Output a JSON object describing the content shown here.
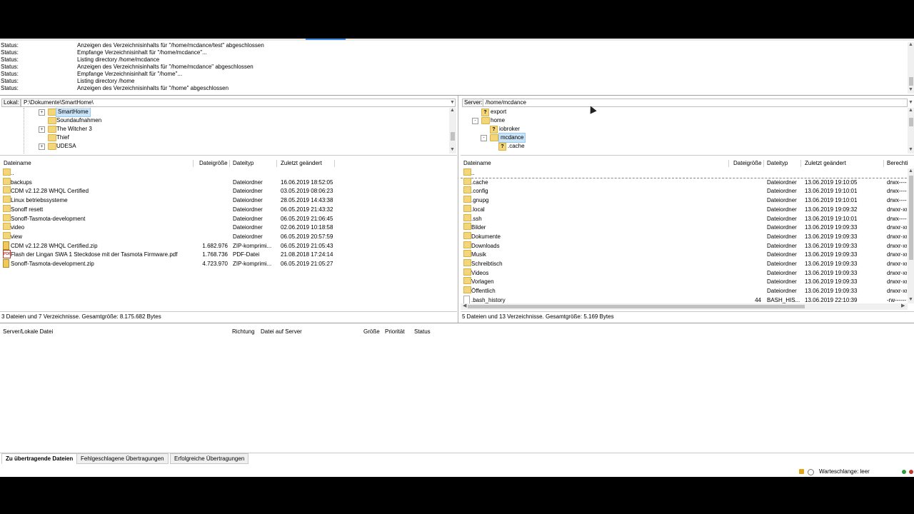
{
  "colors": {
    "selection": "#cce4f7",
    "folder": "#f3d57a",
    "topstrip_accent": "#3c8ddf"
  },
  "log": [
    {
      "k": "Status:",
      "v": "Anzeigen des Verzeichnisinhalts für \"/home/mcdance/test\" abgeschlossen"
    },
    {
      "k": "Status:",
      "v": "Empfange Verzeichnisinhalt für \"/home/mcdance\"..."
    },
    {
      "k": "Status:",
      "v": "Listing directory /home/mcdance"
    },
    {
      "k": "Status:",
      "v": "Anzeigen des Verzeichnisinhalts für \"/home/mcdance\" abgeschlossen"
    },
    {
      "k": "Status:",
      "v": "Empfange Verzeichnisinhalt für \"/home\"..."
    },
    {
      "k": "Status:",
      "v": "Listing directory /home"
    },
    {
      "k": "Status:",
      "v": "Anzeigen des Verzeichnisinhalts für \"/home\" abgeschlossen"
    }
  ],
  "local": {
    "label": "Lokal:",
    "path": "P:\\Dokumente\\SmartHome\\",
    "tree": [
      {
        "name": "SmartHome",
        "expand": "+",
        "selected": true
      },
      {
        "name": "Soundaufnahmen",
        "expand": ""
      },
      {
        "name": "The Witcher 3",
        "expand": "+"
      },
      {
        "name": "Thief",
        "expand": ""
      },
      {
        "name": "UDESA",
        "expand": "+"
      }
    ],
    "headers": {
      "name": "Dateiname",
      "size": "Dateigröße",
      "type": "Dateityp",
      "modified": "Zuletzt geändert"
    },
    "rows": [
      {
        "icon": "folder-icon",
        "name": "..",
        "size": "",
        "type": "",
        "modified": ""
      },
      {
        "icon": "folder-icon",
        "name": "backups",
        "size": "",
        "type": "Dateiordner",
        "modified": "16.06.2019 18:52:05"
      },
      {
        "icon": "folder-icon",
        "name": "CDM v2.12.28 WHQL Certified",
        "size": "",
        "type": "Dateiordner",
        "modified": "03.05.2019 08:06:23"
      },
      {
        "icon": "folder-icon",
        "name": "Linux betriebssysteme",
        "size": "",
        "type": "Dateiordner",
        "modified": "28.05.2019 14:43:38"
      },
      {
        "icon": "folder-icon",
        "name": "Sonoff resett",
        "size": "",
        "type": "Dateiordner",
        "modified": "06.05.2019 21:43:32"
      },
      {
        "icon": "folder-icon",
        "name": "Sonoff-Tasmota-development",
        "size": "",
        "type": "Dateiordner",
        "modified": "06.05.2019 21:06:45"
      },
      {
        "icon": "folder-icon",
        "name": "video",
        "size": "",
        "type": "Dateiordner",
        "modified": "02.06.2019 10:18:58"
      },
      {
        "icon": "folder-icon",
        "name": "view",
        "size": "",
        "type": "Dateiordner",
        "modified": "06.05.2019 20:57:59"
      },
      {
        "icon": "zip-icon",
        "name": "CDM v2.12.28 WHQL Certified.zip",
        "size": "1.682.976",
        "type": "ZIP-komprimi...",
        "modified": "06.05.2019 21:05:43"
      },
      {
        "icon": "pdf-icon",
        "name": "Flash der Lingan SWA 1 Steckdose mit der Tasmota Firmware.pdf",
        "size": "1.768.736",
        "type": "PDF-Datei",
        "modified": "21.08.2018 17:24:14"
      },
      {
        "icon": "zip-icon",
        "name": "Sonoff-Tasmota-development.zip",
        "size": "4.723.970",
        "type": "ZIP-komprimi...",
        "modified": "06.05.2019 21:05:27"
      }
    ],
    "summary": "3 Dateien und 7 Verzeichnisse. Gesamtgröße: 8.175.682 Bytes"
  },
  "remote": {
    "label": "Server:",
    "path": "/home/mcdance",
    "tree": [
      {
        "name": "export",
        "icon": "q",
        "expand": ""
      },
      {
        "name": "home",
        "icon": "folder",
        "expand": "-"
      },
      {
        "name": "iobroker",
        "icon": "q",
        "expand": ""
      },
      {
        "name": "mcdance",
        "icon": "folder",
        "expand": "-",
        "selected": true
      },
      {
        "name": ".cache",
        "icon": "q",
        "expand": ""
      }
    ],
    "headers": {
      "name": "Dateiname",
      "size": "Dateigröße",
      "type": "Dateityp",
      "modified": "Zuletzt geändert",
      "perm": "Berechti"
    },
    "rows": [
      {
        "icon": "folder-icon",
        "name": "..",
        "size": "",
        "type": "",
        "modified": "",
        "perm": ""
      },
      {
        "icon": "folder-icon",
        "name": ".cache",
        "size": "",
        "type": "Dateiordner",
        "modified": "13.06.2019 19:10:05",
        "perm": "drwx------"
      },
      {
        "icon": "folder-icon",
        "name": ".config",
        "size": "",
        "type": "Dateiordner",
        "modified": "13.06.2019 19:10:01",
        "perm": "drwx------"
      },
      {
        "icon": "folder-icon",
        "name": ".gnupg",
        "size": "",
        "type": "Dateiordner",
        "modified": "13.06.2019 19:10:01",
        "perm": "drwx------"
      },
      {
        "icon": "folder-icon",
        "name": ".local",
        "size": "",
        "type": "Dateiordner",
        "modified": "13.06.2019 19:09:32",
        "perm": "drwxr-xr"
      },
      {
        "icon": "folder-icon",
        "name": ".ssh",
        "size": "",
        "type": "Dateiordner",
        "modified": "13.06.2019 19:10:01",
        "perm": "drwx------"
      },
      {
        "icon": "folder-icon",
        "name": "Bilder",
        "size": "",
        "type": "Dateiordner",
        "modified": "13.06.2019 19:09:33",
        "perm": "drwxr-xr"
      },
      {
        "icon": "folder-icon",
        "name": "Dokumente",
        "size": "",
        "type": "Dateiordner",
        "modified": "13.06.2019 19:09:33",
        "perm": "drwxr-xr"
      },
      {
        "icon": "folder-icon",
        "name": "Downloads",
        "size": "",
        "type": "Dateiordner",
        "modified": "13.06.2019 19:09:33",
        "perm": "drwxr-xr"
      },
      {
        "icon": "folder-icon",
        "name": "Musik",
        "size": "",
        "type": "Dateiordner",
        "modified": "13.06.2019 19:09:33",
        "perm": "drwxr-xr"
      },
      {
        "icon": "folder-icon",
        "name": "Schreibtisch",
        "size": "",
        "type": "Dateiordner",
        "modified": "13.06.2019 19:09:33",
        "perm": "drwxr-xr"
      },
      {
        "icon": "folder-icon",
        "name": "Videos",
        "size": "",
        "type": "Dateiordner",
        "modified": "13.06.2019 19:09:33",
        "perm": "drwxr-xr"
      },
      {
        "icon": "folder-icon",
        "name": "Vorlagen",
        "size": "",
        "type": "Dateiordner",
        "modified": "13.06.2019 19:09:33",
        "perm": "drwxr-xr"
      },
      {
        "icon": "folder-icon",
        "name": "Öffentlich",
        "size": "",
        "type": "Dateiordner",
        "modified": "13.06.2019 19:09:33",
        "perm": "drwxr-xr"
      },
      {
        "icon": "file-icon",
        "name": ".bash_history",
        "size": "44",
        "type": "BASH_HIS...",
        "modified": "13.06.2019 22:10:39",
        "perm": "-rw------"
      }
    ],
    "summary": "5 Dateien und 13 Verzeichnisse. Gesamtgröße: 5.169 Bytes"
  },
  "queue": {
    "headers": {
      "server_file": "Server/Lokale Datei",
      "direction": "Richtung",
      "remote_file": "Datei auf Server",
      "size": "Größe",
      "priority": "Priorität",
      "status": "Status"
    },
    "tabs": [
      "Zu übertragende Dateien",
      "Fehlgeschlagene Übertragungen",
      "Erfolgreiche Übertragungen"
    ],
    "active_tab": 0,
    "queue_status": "Warteschlange: leer"
  }
}
